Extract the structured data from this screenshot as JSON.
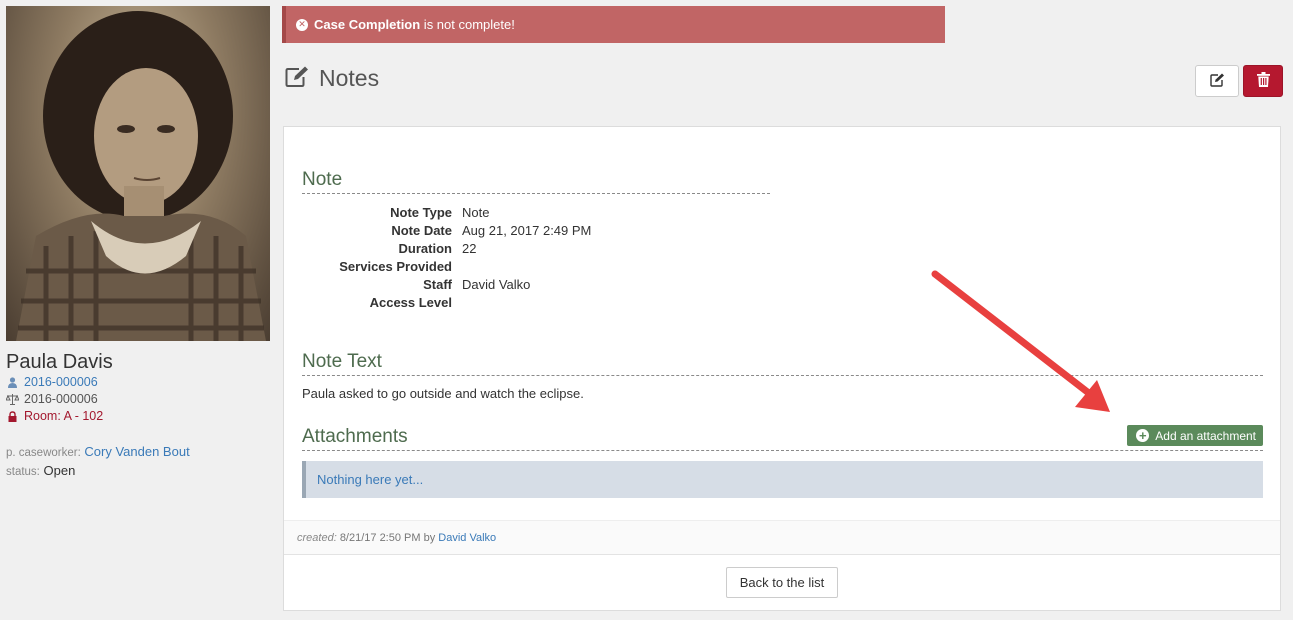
{
  "alert": {
    "bold": "Case Completion",
    "text": " is not complete!"
  },
  "page": {
    "title": "Notes"
  },
  "client": {
    "name": "Paula Davis",
    "case_id": "2016-000006",
    "court_id": "2016-000006",
    "room": "Room: A - 102",
    "caseworker_label": "p. caseworker:",
    "caseworker": "Cory Vanden Bout",
    "status_label": "status:",
    "status": "Open"
  },
  "note": {
    "section_title": "Note",
    "fields": [
      {
        "label": "Note Type",
        "value": "Note"
      },
      {
        "label": "Note Date",
        "value": "Aug 21, 2017 2:49 PM"
      },
      {
        "label": "Duration",
        "value": "22"
      },
      {
        "label": "Services Provided",
        "value": ""
      },
      {
        "label": "Staff",
        "value": "David Valko"
      },
      {
        "label": "Access Level",
        "value": ""
      }
    ]
  },
  "note_text": {
    "section_title": "Note Text",
    "body": "Paula asked to go outside and watch the eclipse."
  },
  "attachments": {
    "section_title": "Attachments",
    "add_label": "Add an attachment",
    "empty_message": "Nothing here yet..."
  },
  "created": {
    "label": "created:",
    "date": "8/21/17 2:50 PM",
    "by": "by",
    "author": "David Valko"
  },
  "footer": {
    "back_label": "Back to the list"
  },
  "colors": {
    "alert_bg": "#c16565",
    "delete_button": "#b5182f",
    "add_button": "#5b8a5b",
    "section_title": "#4e6b4e",
    "link": "#3a7ab8",
    "arrow": "#e8403f"
  },
  "icons": {
    "alert": "times-circle-icon",
    "heading": "edit-icon",
    "edit_button": "pencil-icon",
    "delete_button": "trash-icon",
    "case_id": "user-icon",
    "court_id": "balance-scale-icon",
    "room": "lock-icon",
    "add": "plus-circle-icon"
  }
}
